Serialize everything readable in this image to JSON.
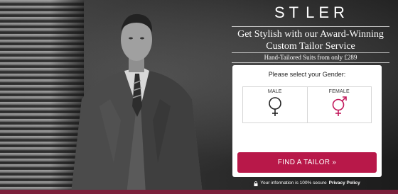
{
  "brand": {
    "logo_left": "ST",
    "logo_right": "LER"
  },
  "hero": {
    "headline": "Get Stylish with our Award-Winning Custom Tailor Service",
    "subline": "Hand-Tailored Suits from only £289"
  },
  "form": {
    "title": "Please select your Gender:",
    "options": [
      {
        "label": "MALE",
        "icon": "male-symbol-icon"
      },
      {
        "label": "FEMALE",
        "icon": "female-symbol-icon"
      }
    ],
    "submit_label": "FIND A TAILOR »"
  },
  "footer": {
    "secure_text": "Your information is 100% secure",
    "privacy_label": "Privacy Policy"
  },
  "colors": {
    "accent": "#b81849",
    "female_icon": "#c2185b",
    "male_icon": "#222222",
    "bottom_bar": "#7b1f3b"
  }
}
